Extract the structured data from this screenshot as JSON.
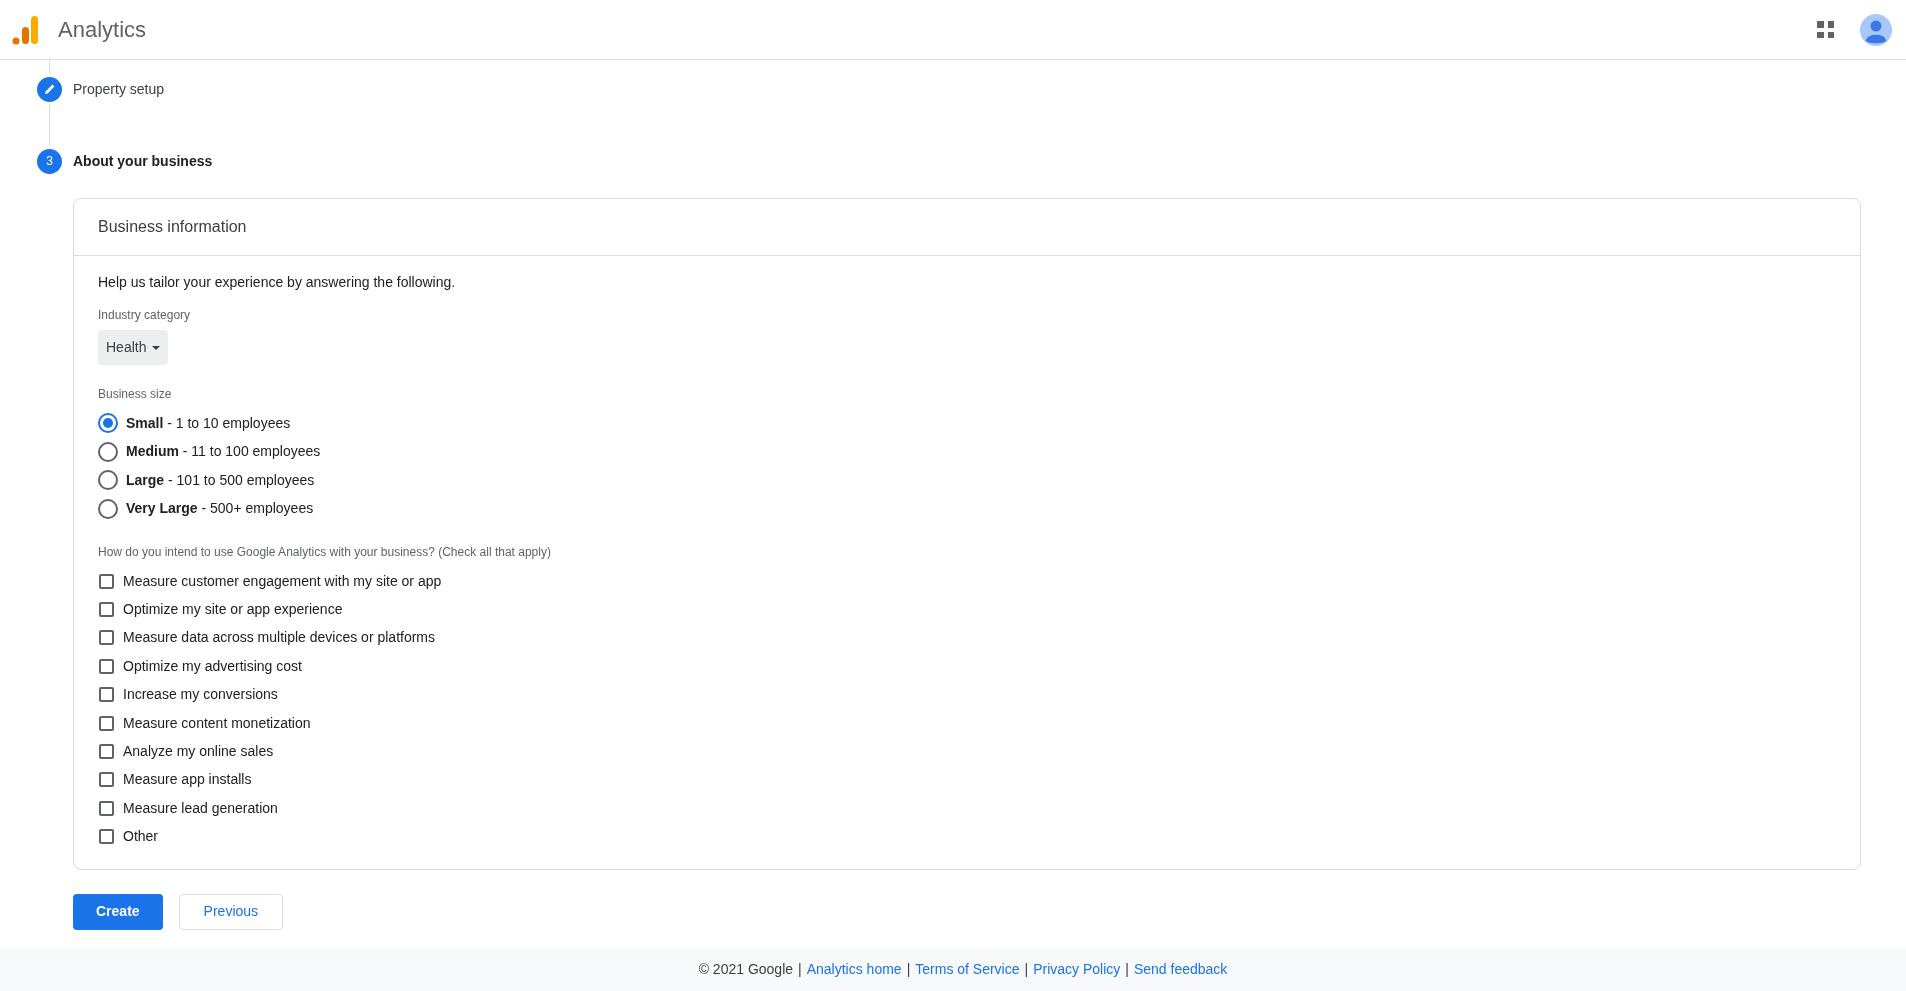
{
  "header": {
    "title": "Analytics"
  },
  "steps": [
    {
      "kind": "edit",
      "label": "Property setup",
      "current": false
    },
    {
      "kind": "number",
      "number": "3",
      "label": "About your business",
      "current": true
    }
  ],
  "card": {
    "title": "Business information",
    "intro": "Help us tailor your experience by answering the following.",
    "industry": {
      "label": "Industry category",
      "value": "Health"
    },
    "size": {
      "label": "Business size",
      "options": [
        {
          "label": "**Small** - 1 to 10 employees",
          "selected": true
        },
        {
          "label": "**Medium** - 11 to 100 employees",
          "selected": false
        },
        {
          "label": "**Large** - 101 to 500 employees",
          "selected": false
        },
        {
          "label": "**Very Large** - 500+ employees",
          "selected": false
        }
      ]
    },
    "usage": {
      "label": "How do you intend to use Google Analytics with your business? (Check all that apply)",
      "options": [
        {
          "label": "Measure customer engagement with my site or app",
          "checked": false
        },
        {
          "label": "Optimize my site or app experience",
          "checked": false
        },
        {
          "label": "Measure data across multiple devices or platforms",
          "checked": false
        },
        {
          "label": "Optimize my advertising cost",
          "checked": false
        },
        {
          "label": "Increase my conversions",
          "checked": false
        },
        {
          "label": "Measure content monetization",
          "checked": false
        },
        {
          "label": "Analyze my online sales",
          "checked": false
        },
        {
          "label": "Measure app installs",
          "checked": false
        },
        {
          "label": "Measure lead generation",
          "checked": false
        },
        {
          "label": "Other",
          "checked": false
        }
      ]
    }
  },
  "buttons": [
    {
      "kind": "primary",
      "label": "Create"
    },
    {
      "kind": "secondary",
      "label": "Previous"
    }
  ],
  "footer": {
    "copyright": "© 2021 Google",
    "separator": "|",
    "links": [
      "Analytics home",
      "Terms of Service",
      "Privacy Policy",
      "Send feedback"
    ]
  }
}
